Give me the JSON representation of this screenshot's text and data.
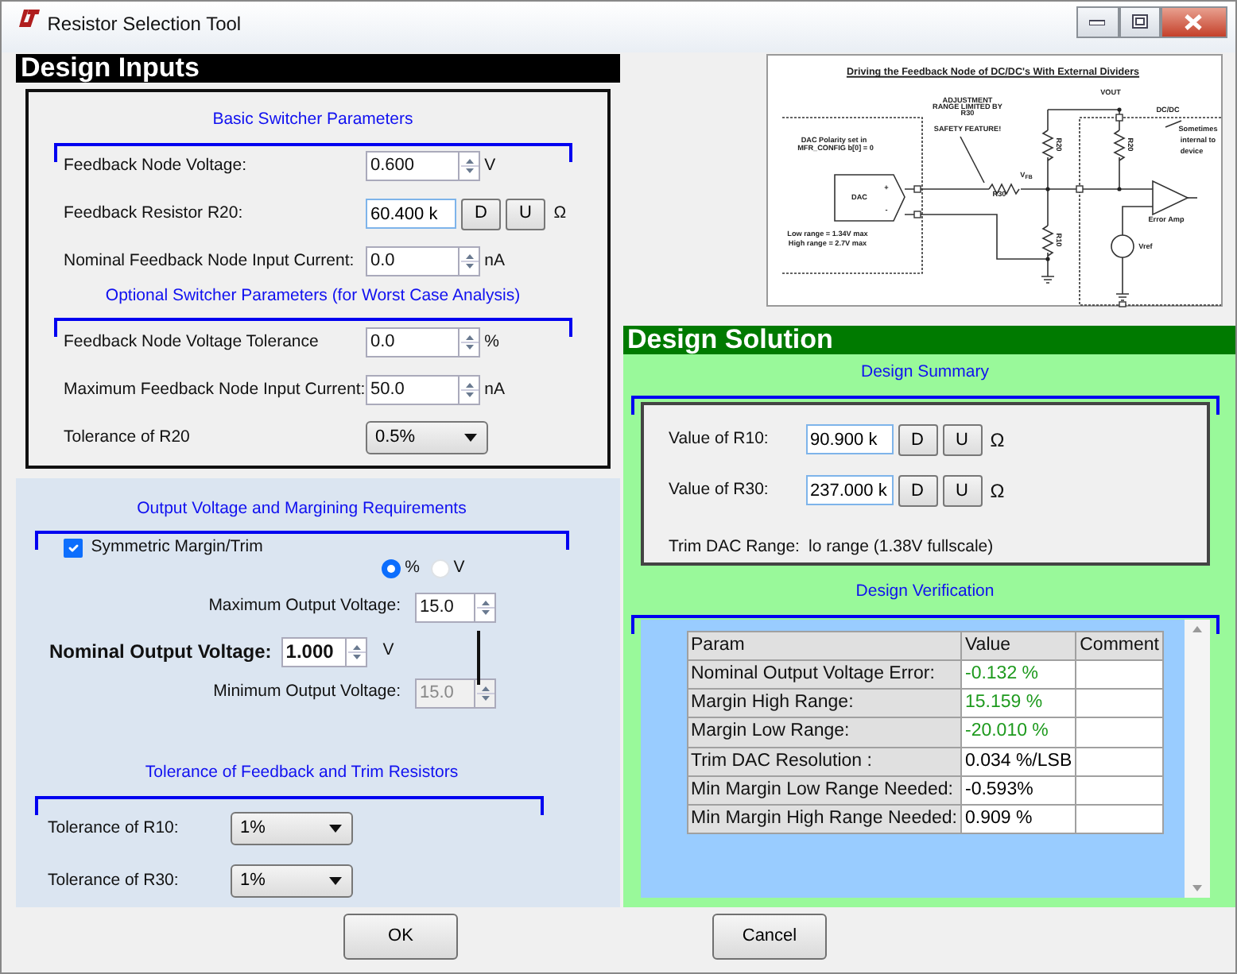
{
  "window": {
    "title": "Resistor Selection Tool"
  },
  "design_inputs": {
    "title": "Design Inputs",
    "basic": {
      "heading": "Basic Switcher Parameters",
      "fields": [
        {
          "kind": "spin",
          "label": "Feedback Node Voltage:",
          "value": "0.600",
          "unit": "V"
        },
        {
          "kind": "step",
          "label": "Feedback Resistor R20:",
          "value": "60.400 k",
          "buttons": [
            "D",
            "U"
          ],
          "unit": "Ω"
        },
        {
          "kind": "spin",
          "label": "Nominal Feedback Node Input Current:",
          "value": "0.0",
          "unit": "nA"
        }
      ]
    },
    "optional": {
      "heading": "Optional Switcher Parameters (for Worst Case Analysis)",
      "fields": [
        {
          "kind": "spin",
          "label": "Feedback Node Voltage Tolerance",
          "value": "0.0",
          "unit": "%"
        },
        {
          "kind": "spin",
          "label": "Maximum Feedback Node Input Current:",
          "value": "50.0",
          "unit": "nA"
        },
        {
          "kind": "select",
          "label": "Tolerance of R20",
          "value": "0.5%"
        }
      ]
    }
  },
  "margining": {
    "heading": "Output Voltage and Margining Requirements",
    "symmetric": {
      "label": "Symmetric Margin/Trim",
      "checked": true
    },
    "units": [
      {
        "label": "%",
        "selected": true
      },
      {
        "label": "V",
        "selected": false
      }
    ],
    "maximum": {
      "label": "Maximum Output Voltage:",
      "value": "15.0",
      "disabled": false
    },
    "nominal": {
      "label": "Nominal Output Voltage:",
      "value": "1.000",
      "unit": "V"
    },
    "minimum": {
      "label": "Minimum Output Voltage:",
      "value": "15.0",
      "disabled": true
    }
  },
  "tolerances": {
    "heading": "Tolerance of Feedback and Trim Resistors",
    "fields": [
      {
        "label": "Tolerance of R10:",
        "value": "1%"
      },
      {
        "label": "Tolerance of R30:",
        "value": "1%"
      }
    ]
  },
  "diagram": {
    "title": "Driving the Feedback Node of DC/DC's With External Dividers",
    "labels": [
      "ADJUSTMENT",
      "RANGE LIMITED BY",
      "R30",
      "SAFETY FEATURE!",
      "VOUT",
      "DC/DC",
      "Sometimes",
      "internal to",
      "device",
      "DAC Polarity set in",
      "MFR_CONFIG b[0] = 0",
      "DAC",
      "+",
      "-",
      "R30",
      "V$_{FB}$",
      "R20",
      "R20",
      "R10",
      "Low range = 1.34V max",
      "High range = 2.7V max",
      "Error Amp",
      "Vref"
    ]
  },
  "design_solution": {
    "title": "Design Solution",
    "summary": {
      "heading": "Design Summary",
      "values": [
        {
          "label": "Value of R10:",
          "value": "90.900 k",
          "buttons": [
            "D",
            "U"
          ],
          "unit": "Ω"
        },
        {
          "label": "Value of R30:",
          "value": "237.000 k",
          "buttons": [
            "D",
            "U"
          ],
          "unit": "Ω"
        }
      ],
      "trim": {
        "label": "Trim DAC Range:",
        "value": "lo range (1.38V fullscale)"
      }
    },
    "verification": {
      "heading": "Design Verification",
      "columns": [
        "Param",
        "Value",
        "Comment"
      ],
      "rows": [
        {
          "param": "Nominal Output Voltage Error:",
          "value": "-0.132 %",
          "color": "#1e9a1e"
        },
        {
          "param": "Margin High Range:",
          "value": "15.159 %",
          "color": "#1e9a1e"
        },
        {
          "param": "Margin Low Range:",
          "value": "-20.010 %",
          "color": "#1e9a1e"
        },
        {
          "param": "Trim DAC Resolution :",
          "value": "0.034 %/LSB",
          "color": "#000000"
        },
        {
          "param": "Min Margin Low Range Needed:",
          "value": "-0.593%",
          "color": "#000000"
        },
        {
          "param": "Min Margin High Range Needed:",
          "value": "0.909 %",
          "color": "#000000"
        }
      ]
    }
  },
  "buttons": [
    "OK",
    "Cancel"
  ]
}
